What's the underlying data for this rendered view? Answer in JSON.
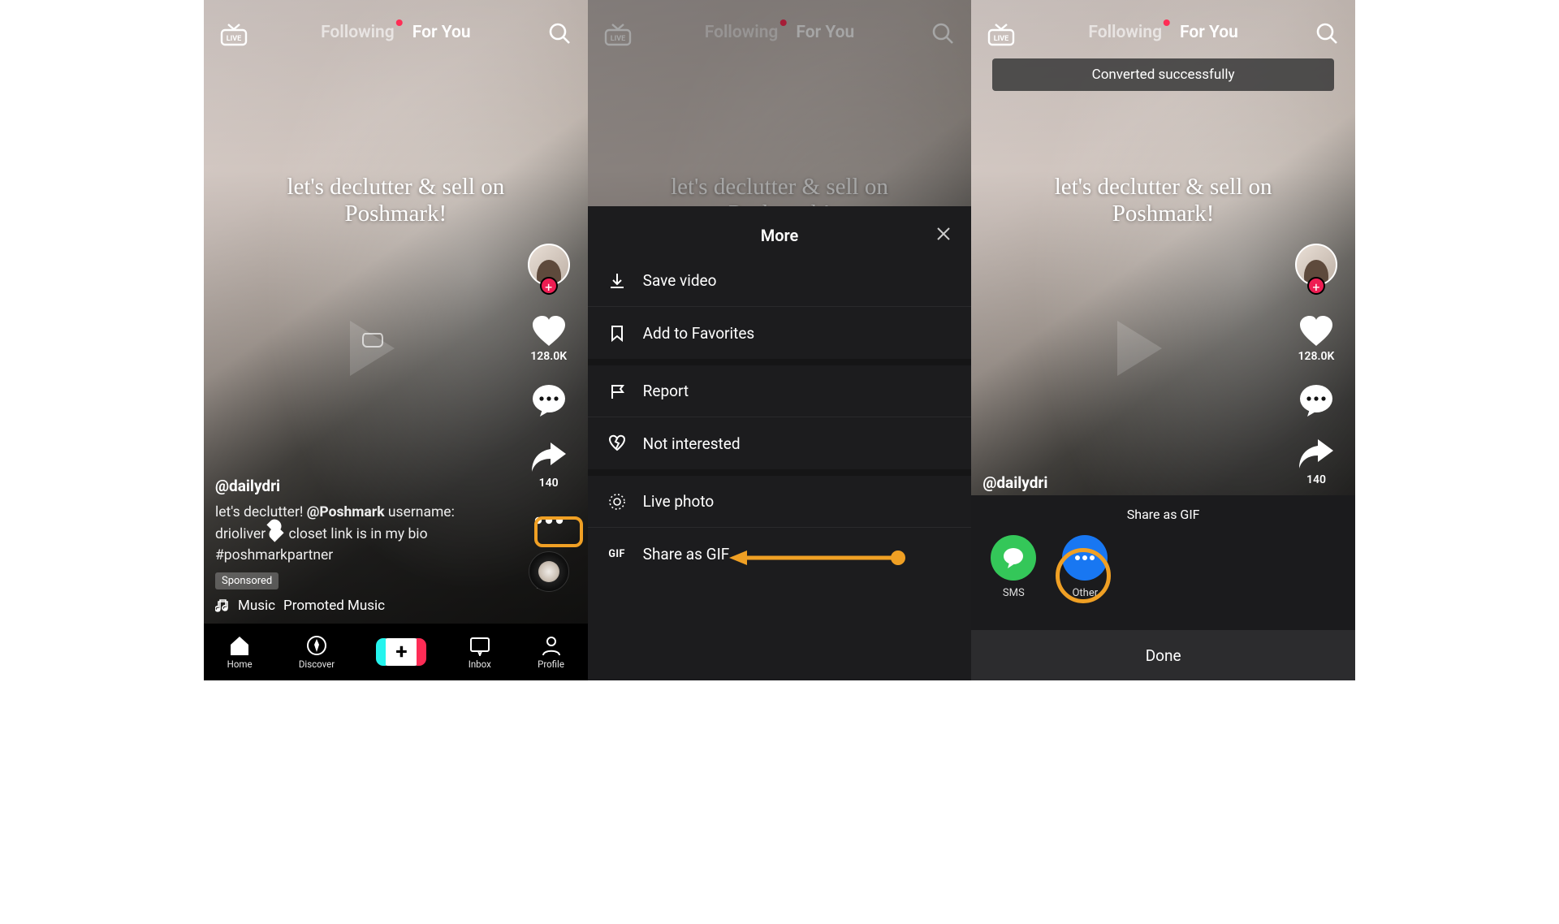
{
  "header": {
    "tab_following": "Following",
    "tab_for_you": "For You"
  },
  "caption_overlay": "let's declutter & sell on Poshmark!",
  "rail": {
    "likes": "128.0K",
    "comments": "",
    "shares": "140"
  },
  "meta": {
    "handle": "@dailydri",
    "desc_line1": "let's declutter! ",
    "desc_mention": "@Poshmark",
    "desc_line1b": " username: drioliver",
    "desc_line2": " closet link is in my bio ",
    "hashtag": "#poshmarkpartner",
    "sponsored": "Sponsored",
    "music_label": "Music",
    "music_title": "Promoted Music"
  },
  "tabbar": {
    "home": "Home",
    "discover": "Discover",
    "inbox": "Inbox",
    "profile": "Profile"
  },
  "more_sheet": {
    "title": "More",
    "save_video": "Save video",
    "add_favorites": "Add to Favorites",
    "report": "Report",
    "not_interested": "Not interested",
    "live_photo": "Live photo",
    "share_gif": "Share as GIF"
  },
  "toast": "Converted successfully",
  "gif_sheet": {
    "title": "Share as GIF",
    "sms": "SMS",
    "other": "Other",
    "done": "Done"
  }
}
